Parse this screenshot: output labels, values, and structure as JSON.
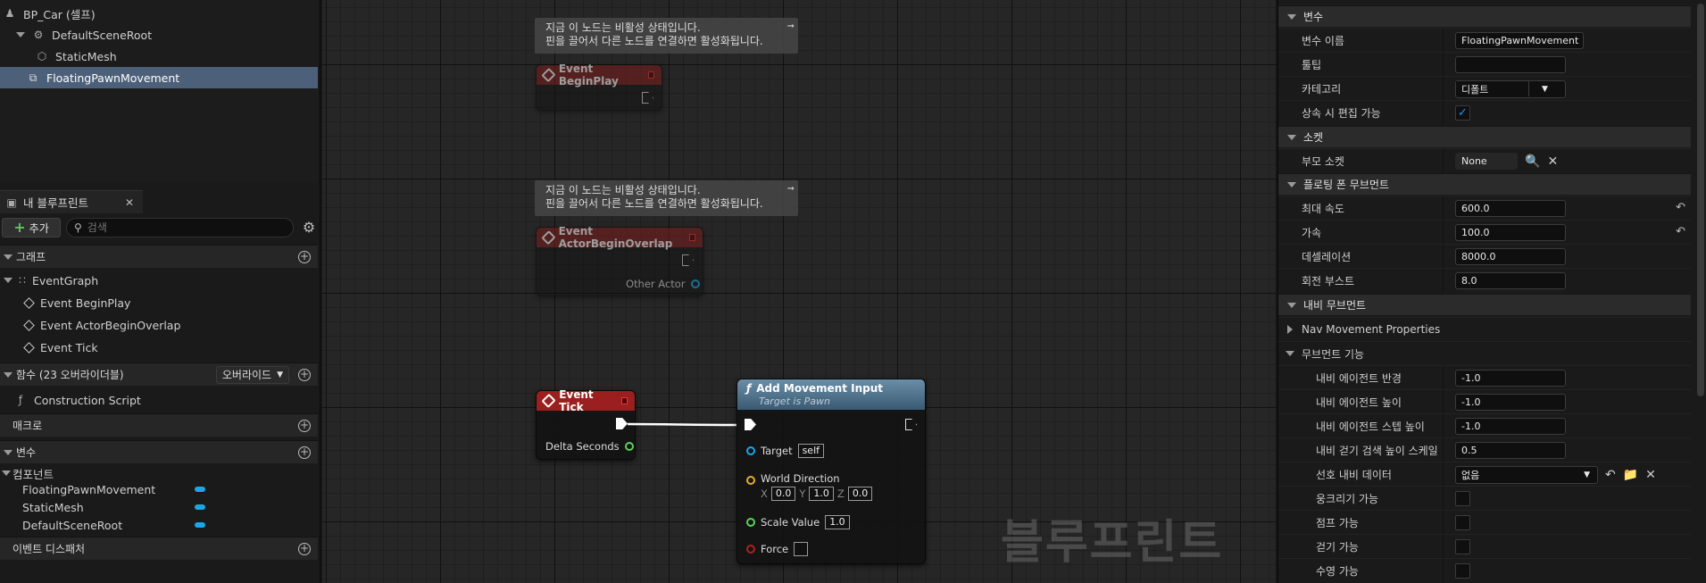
{
  "components": {
    "root_label": "BP_Car (셀프)",
    "items": [
      {
        "label": "DefaultSceneRoot"
      },
      {
        "label": "StaticMesh"
      },
      {
        "label": "FloatingPawnMovement"
      }
    ]
  },
  "my_blueprint": {
    "tab_label": "내 블루프린트",
    "add_label": "추가",
    "search_placeholder": "검색",
    "sections": {
      "graphs": "그래프",
      "functions": "함수 (23 오버라이더블)",
      "functions_override": "오버라이드",
      "macros": "매크로",
      "variables": "변수",
      "components_cat": "컴포넌트",
      "event_dispatchers": "이벤트 디스패처"
    },
    "event_graph": "EventGraph",
    "events": [
      "Event BeginPlay",
      "Event ActorBeginOverlap",
      "Event Tick"
    ],
    "construction_script": "Construction Script",
    "variables": [
      "FloatingPawnMovement",
      "StaticMesh",
      "DefaultSceneRoot"
    ],
    "colors": {
      "variable_pill": "#19a7e8",
      "selection": "#4d6079"
    }
  },
  "graph": {
    "comment_line1": "지금 이 노드는 비활성 상태입니다.",
    "comment_line2": "핀을 끌어서 다른 노드를 연결하면 활성화됩니다.",
    "beginplay_title": "Event BeginPlay",
    "overlap_title": "Event ActorBeginOverlap",
    "other_actor": "Other Actor",
    "tick_title": "Event Tick",
    "delta_seconds": "Delta Seconds",
    "amv_title": "Add Movement Input",
    "amv_subtitle": "Target is Pawn",
    "target_label": "Target",
    "target_value": "self",
    "world_direction": "World Direction",
    "x_label": "X",
    "x_value": "0.0",
    "y_label": "Y",
    "y_value": "1.0",
    "z_label": "Z",
    "z_value": "0.0",
    "scale_label": "Scale Value",
    "scale_value": "1.0",
    "force_label": "Force",
    "watermark": "블루프린트"
  },
  "details": {
    "cat_variable": "변수",
    "var_name_label": "변수 이름",
    "var_name_value": "FloatingPawnMovement",
    "tooltip_label": "툴팁",
    "tooltip_value": "",
    "category_label": "카테고리",
    "category_value": "디폴트",
    "editable_label": "상속 시 편집 가능",
    "cat_socket": "소켓",
    "parent_socket_label": "부모 소켓",
    "parent_socket_value": "None",
    "cat_floating": "플로팅 폰 무브먼트",
    "max_speed_label": "최대 속도",
    "max_speed_value": "600.0",
    "accel_label": "가속",
    "accel_value": "100.0",
    "decel_label": "데셀레이션",
    "decel_value": "8000.0",
    "turn_boost_label": "회전 부스트",
    "turn_boost_value": "8.0",
    "cat_nav": "내비 무브먼트",
    "nav_props": "Nav Movement Properties",
    "cat_move_cap": "무브먼트 기능",
    "agent_radius_label": "내비 에이전트 반경",
    "agent_radius_value": "-1.0",
    "agent_height_label": "내비 에이전트 높이",
    "agent_height_value": "-1.0",
    "agent_step_label": "내비 에이전트 스텝 높이",
    "agent_step_value": "-1.0",
    "walk_search_label": "내비 걷기 검색 높이 스케일",
    "walk_search_value": "0.5",
    "pref_nav_label": "선호 내비 데이터",
    "pref_nav_value": "없음",
    "crouch_label": "웅크리기 가능",
    "jump_label": "점프 가능",
    "walk_label": "걷기 가능",
    "swim_label": "수영 가능"
  }
}
